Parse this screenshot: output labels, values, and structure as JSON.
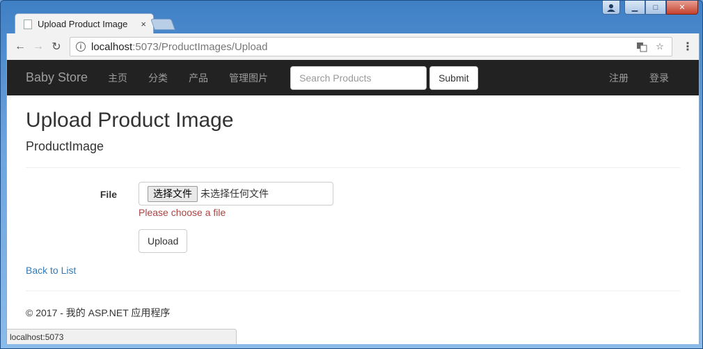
{
  "browser": {
    "tab_title": "Upload Product Image",
    "tab_close": "×",
    "url_host": "localhost",
    "url_path": ":5073/ProductImages/Upload",
    "status_url": "localhost:5073"
  },
  "navbar": {
    "brand": "Baby Store",
    "links": [
      "主页",
      "分类",
      "产品",
      "管理图片"
    ],
    "search_placeholder": "Search Products",
    "submit_label": "Submit",
    "right_links": [
      "注册",
      "登录"
    ]
  },
  "page": {
    "title": "Upload Product Image",
    "subtitle": "ProductImage",
    "file_label": "File",
    "file_button": "选择文件",
    "file_status": "未选择任何文件",
    "file_error": "Please choose a file",
    "upload_label": "Upload",
    "back_link": "Back to List",
    "footer": "© 2017 - 我的 ASP.NET 应用程序"
  },
  "colors": {
    "navbar_bg": "#222222",
    "link": "#337ab7",
    "error": "#a94442"
  }
}
